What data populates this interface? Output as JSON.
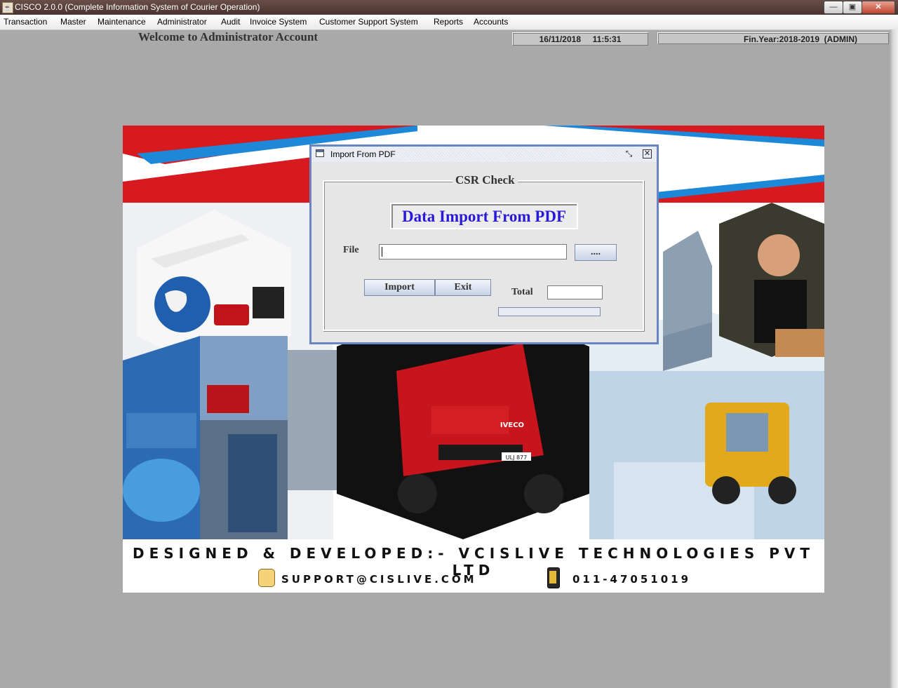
{
  "window": {
    "title": "CISCO 2.0.0 (Complete Information System of Courier Operation)",
    "app_icon": "java-cup-icon",
    "controls": [
      "minimize",
      "maximize",
      "close"
    ],
    "minimize_glyph": "—",
    "maximize_glyph": "▣",
    "close_glyph": "✕"
  },
  "menubar": {
    "items": [
      "Transaction",
      "Master",
      "Maintenance",
      "Administrator",
      "Audit",
      "Invoice System",
      "Customer Support System",
      "Reports",
      "Accounts"
    ]
  },
  "header": {
    "welcome": "Welcome to Administrator Account",
    "datetime": "16/11/2018     11:5:31",
    "finyear": "Fin.Year:2018-2019  (ADMIN)"
  },
  "banner": {
    "credit": "DESIGNED & DEVELOPED:- VCISLIVE TECHNOLOGIES PVT LTD",
    "email": "SUPPORT@CISLIVE.COM",
    "phone": "011-47051019",
    "truck_brand": "IVECO",
    "truck_plate": "ULJ 877",
    "colors": {
      "red": "#d71920",
      "blue": "#1e88d8",
      "dark": "#111111"
    }
  },
  "dialog": {
    "title": "Import From PDF",
    "restore_glyph": "⤡",
    "close_glyph": "✕",
    "group_title": "CSR Check",
    "heading": "Data Import From PDF",
    "file_label": "File",
    "file_value": "",
    "browse_label": "....",
    "import_label": "Import",
    "exit_label": "Exit",
    "total_label": "Total",
    "total_value": "",
    "progress": 0,
    "accent": "#6a86c2"
  }
}
